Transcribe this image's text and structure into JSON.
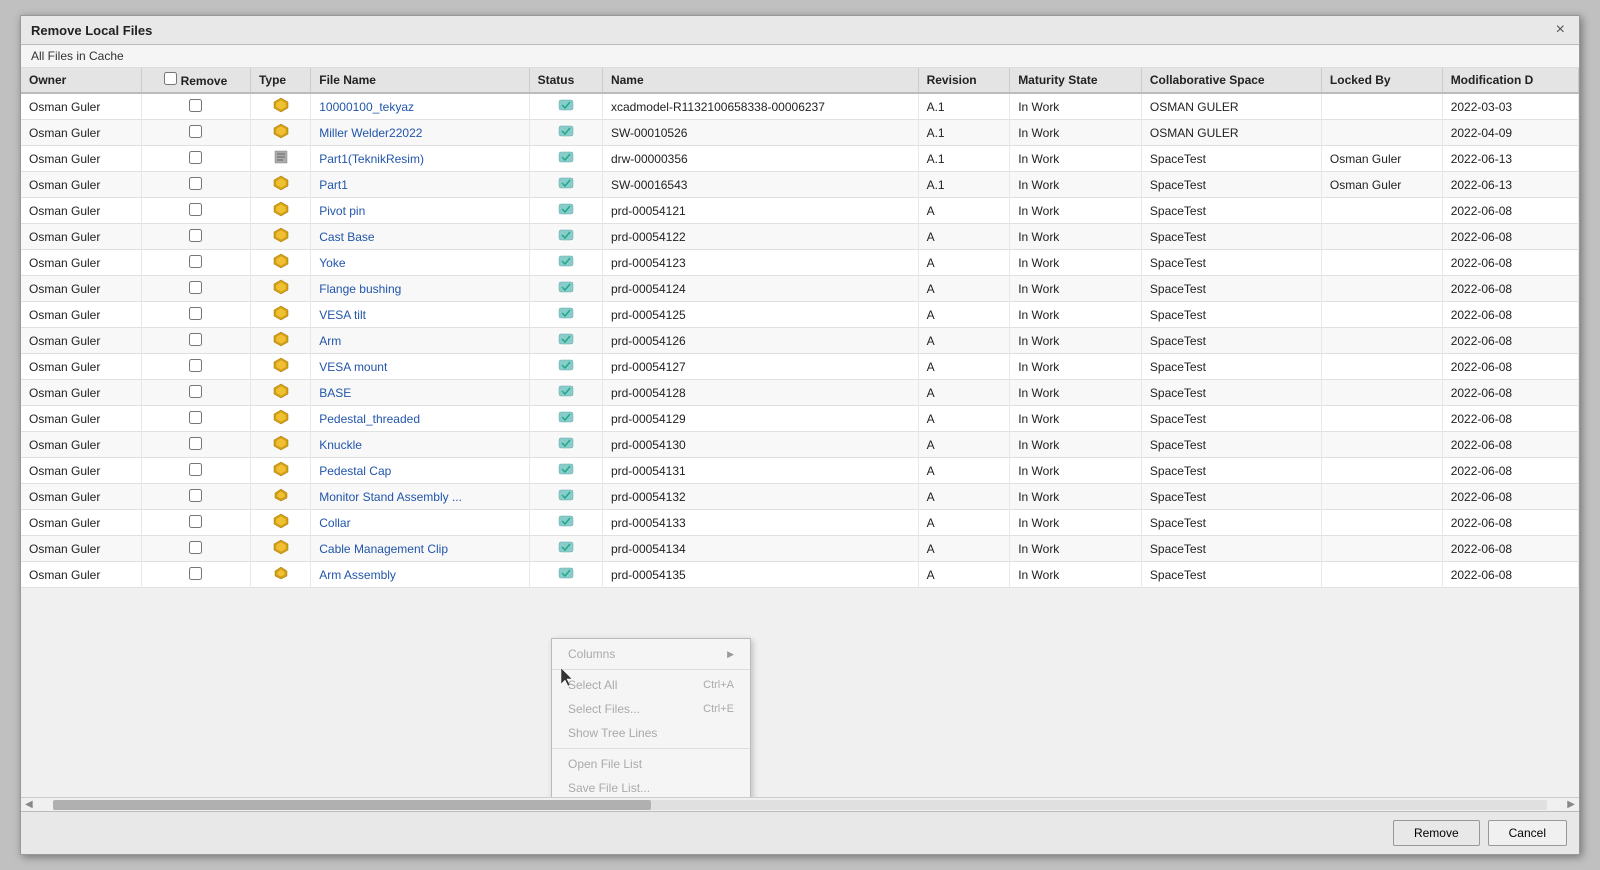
{
  "dialog": {
    "title": "Remove Local Files",
    "subtitle": "All Files in Cache",
    "close_label": "×"
  },
  "header_checkbox_label": "",
  "columns": [
    {
      "key": "owner",
      "label": "Owner"
    },
    {
      "key": "remove",
      "label": "Remove"
    },
    {
      "key": "type",
      "label": "Type"
    },
    {
      "key": "filename",
      "label": "File Name"
    },
    {
      "key": "status",
      "label": "Status"
    },
    {
      "key": "name",
      "label": "Name"
    },
    {
      "key": "revision",
      "label": "Revision"
    },
    {
      "key": "maturity",
      "label": "Maturity State"
    },
    {
      "key": "collab",
      "label": "Collaborative Space"
    },
    {
      "key": "locked",
      "label": "Locked By"
    },
    {
      "key": "modification",
      "label": "Modification D"
    }
  ],
  "rows": [
    {
      "owner": "Osman Guler",
      "type": "part",
      "filename": "10000100_tekyaz",
      "name": "xcadmodel-R1132100658338-00006237",
      "revision": "A.1",
      "maturity": "In Work",
      "collab": "OSMAN GULER",
      "locked": "",
      "modification": "2022-03-03"
    },
    {
      "owner": "Osman Guler",
      "type": "part",
      "filename": "Miller Welder22022",
      "name": "SW-00010526",
      "revision": "A.1",
      "maturity": "In Work",
      "collab": "OSMAN GULER",
      "locked": "",
      "modification": "2022-04-09"
    },
    {
      "owner": "Osman Guler",
      "type": "drawing",
      "filename": "Part1(TeknikResim)",
      "name": "drw-00000356",
      "revision": "A.1",
      "maturity": "In Work",
      "collab": "SpaceTest",
      "locked": "Osman Guler",
      "modification": "2022-06-13"
    },
    {
      "owner": "Osman Guler",
      "type": "part",
      "filename": "Part1",
      "name": "SW-00016543",
      "revision": "A.1",
      "maturity": "In Work",
      "collab": "SpaceTest",
      "locked": "Osman Guler",
      "modification": "2022-06-13"
    },
    {
      "owner": "Osman Guler",
      "type": "part",
      "filename": "Pivot pin",
      "name": "prd-00054121",
      "revision": "A",
      "maturity": "In Work",
      "collab": "SpaceTest",
      "locked": "",
      "modification": "2022-06-08"
    },
    {
      "owner": "Osman Guler",
      "type": "part",
      "filename": "Cast Base",
      "name": "prd-00054122",
      "revision": "A",
      "maturity": "In Work",
      "collab": "SpaceTest",
      "locked": "",
      "modification": "2022-06-08"
    },
    {
      "owner": "Osman Guler",
      "type": "part",
      "filename": "Yoke",
      "name": "prd-00054123",
      "revision": "A",
      "maturity": "In Work",
      "collab": "SpaceTest",
      "locked": "",
      "modification": "2022-06-08"
    },
    {
      "owner": "Osman Guler",
      "type": "part",
      "filename": "Flange bushing",
      "name": "prd-00054124",
      "revision": "A",
      "maturity": "In Work",
      "collab": "SpaceTest",
      "locked": "",
      "modification": "2022-06-08"
    },
    {
      "owner": "Osman Guler",
      "type": "part",
      "filename": "VESA tilt",
      "name": "prd-00054125",
      "revision": "A",
      "maturity": "In Work",
      "collab": "SpaceTest",
      "locked": "",
      "modification": "2022-06-08"
    },
    {
      "owner": "Osman Guler",
      "type": "part",
      "filename": "Arm",
      "name": "prd-00054126",
      "revision": "A",
      "maturity": "In Work",
      "collab": "SpaceTest",
      "locked": "",
      "modification": "2022-06-08"
    },
    {
      "owner": "Osman Guler",
      "type": "part",
      "filename": "VESA mount",
      "name": "prd-00054127",
      "revision": "A",
      "maturity": "In Work",
      "collab": "SpaceTest",
      "locked": "",
      "modification": "2022-06-08"
    },
    {
      "owner": "Osman Guler",
      "type": "part",
      "filename": "BASE",
      "name": "prd-00054128",
      "revision": "A",
      "maturity": "In Work",
      "collab": "SpaceTest",
      "locked": "",
      "modification": "2022-06-08"
    },
    {
      "owner": "Osman Guler",
      "type": "part",
      "filename": "Pedestal_threaded",
      "name": "prd-00054129",
      "revision": "A",
      "maturity": "In Work",
      "collab": "SpaceTest",
      "locked": "",
      "modification": "2022-06-08"
    },
    {
      "owner": "Osman Guler",
      "type": "part",
      "filename": "Knuckle",
      "name": "prd-00054130",
      "revision": "A",
      "maturity": "In Work",
      "collab": "SpaceTest",
      "locked": "",
      "modification": "2022-06-08"
    },
    {
      "owner": "Osman Guler",
      "type": "part",
      "filename": "Pedestal Cap",
      "name": "prd-00054131",
      "revision": "A",
      "maturity": "In Work",
      "collab": "SpaceTest",
      "locked": "",
      "modification": "2022-06-08"
    },
    {
      "owner": "Osman Guler",
      "type": "assembly",
      "filename": "Monitor Stand Assembly ...",
      "name": "prd-00054132",
      "revision": "A",
      "maturity": "In Work",
      "collab": "SpaceTest",
      "locked": "",
      "modification": "2022-06-08"
    },
    {
      "owner": "Osman Guler",
      "type": "part",
      "filename": "Collar",
      "name": "prd-00054133",
      "revision": "A",
      "maturity": "In Work",
      "collab": "SpaceTest",
      "locked": "",
      "modification": "2022-06-08"
    },
    {
      "owner": "Osman Guler",
      "type": "part",
      "filename": "Cable Management Clip",
      "name": "prd-00054134",
      "revision": "A",
      "maturity": "In Work",
      "collab": "SpaceTest",
      "locked": "",
      "modification": "2022-06-08"
    },
    {
      "owner": "Osman Guler",
      "type": "assembly",
      "filename": "Arm Assembly",
      "name": "prd-00054135",
      "revision": "A",
      "maturity": "In Work",
      "collab": "SpaceTest",
      "locked": "",
      "modification": "2022-06-08"
    }
  ],
  "context_menu": {
    "items": [
      {
        "label": "Columns",
        "shortcut": "",
        "has_submenu": true
      },
      {
        "label": "Select All",
        "shortcut": "Ctrl+A",
        "has_submenu": false
      },
      {
        "label": "Select Files...",
        "shortcut": "Ctrl+E",
        "has_submenu": false
      },
      {
        "label": "Show Tree Lines",
        "shortcut": "",
        "has_submenu": false
      },
      {
        "label": "Open File List",
        "shortcut": "",
        "has_submenu": false
      },
      {
        "label": "Save File List...",
        "shortcut": "",
        "has_submenu": false
      }
    ]
  },
  "footer": {
    "remove_label": "Remove",
    "cancel_label": "Cancel"
  }
}
